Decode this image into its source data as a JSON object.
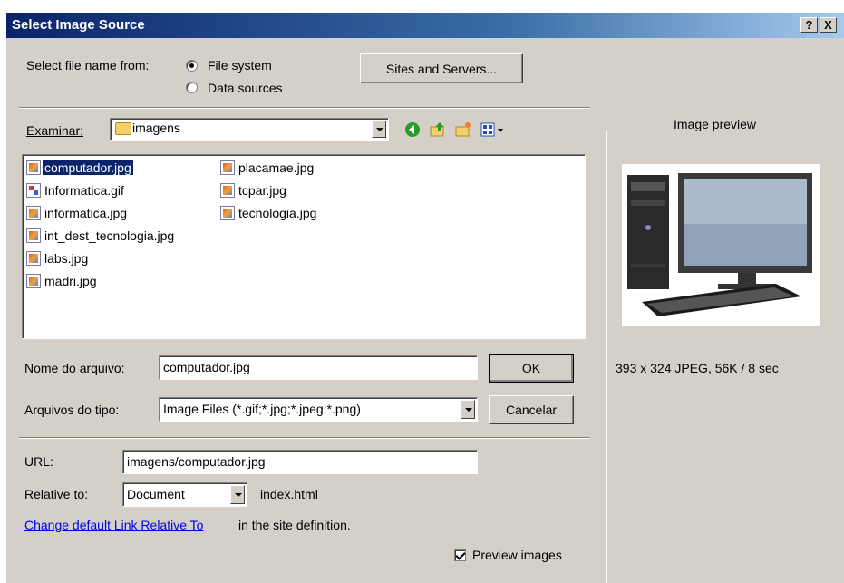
{
  "window": {
    "title": "Select Image Source",
    "help_label": "?",
    "close_label": "X"
  },
  "source": {
    "label": "Select file name from:",
    "options": [
      "File system",
      "Data sources"
    ],
    "selected": "File system",
    "sites_button": "Sites and Servers..."
  },
  "browser": {
    "look_in_label": "Examinar:",
    "folder": "imagens",
    "files_col1": [
      "computador.jpg",
      "Informatica.gif",
      "informatica.jpg",
      "int_dest_tecnologia.jpg",
      "labs.jpg",
      "madri.jpg"
    ],
    "files_col2": [
      "placamae.jpg",
      "tcpar.jpg",
      "tecnologia.jpg"
    ],
    "selected_file": "computador.jpg"
  },
  "filename": {
    "label": "Nome do arquivo:",
    "value": "computador.jpg",
    "ok_button": "OK"
  },
  "filetype": {
    "label": "Arquivos do tipo:",
    "value": "Image Files (*.gif;*.jpg;*.jpeg;*.png)",
    "cancel_button": "Cancelar"
  },
  "url": {
    "label": "URL:",
    "value": "imagens/computador.jpg"
  },
  "relative": {
    "label": "Relative to:",
    "value": "Document",
    "page": "index.html"
  },
  "link": {
    "text": "Change default Link Relative To",
    "suffix": " in the site definition."
  },
  "preview": {
    "title": "Image preview",
    "info": "393 x 324 JPEG, 56K / 8 sec",
    "checkbox_label": "Preview images",
    "checked": true
  },
  "colors": {
    "titlebar": "#0a246a",
    "face": "#d4d0c8",
    "selection": "#0a246a",
    "link": "#0000ee"
  }
}
